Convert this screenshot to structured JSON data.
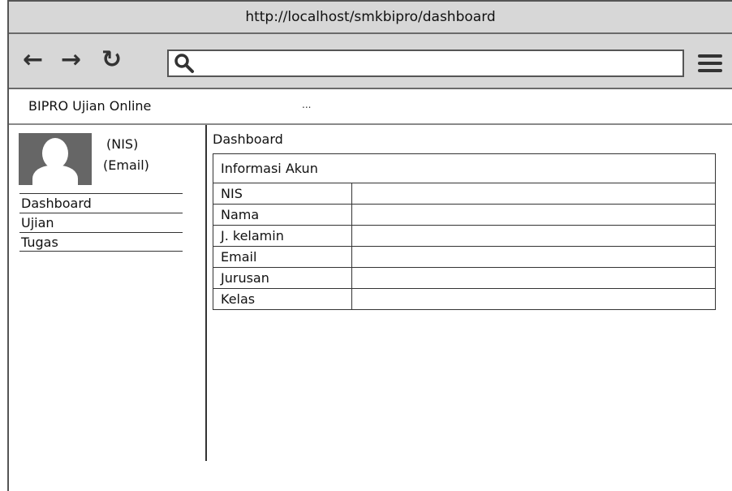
{
  "browser": {
    "url_title": "http://localhost/smkbipro/dashboard",
    "nav": {
      "back": "←",
      "forward": "→",
      "reload": "↻"
    },
    "search_value": ""
  },
  "app": {
    "brand": "BIPRO Ujian Online",
    "more": "..."
  },
  "user": {
    "nis": "(NIS)",
    "email": "(Email)"
  },
  "sidebar": {
    "items": [
      {
        "label": "Dashboard"
      },
      {
        "label": "Ujian"
      },
      {
        "label": "Tugas"
      }
    ]
  },
  "main": {
    "title": "Dashboard",
    "panel_title": "Informasi Akun",
    "rows": [
      {
        "label": "NIS",
        "value": ""
      },
      {
        "label": "Nama",
        "value": ""
      },
      {
        "label": "J. kelamin",
        "value": ""
      },
      {
        "label": "Email",
        "value": ""
      },
      {
        "label": "Jurusan",
        "value": ""
      },
      {
        "label": "Kelas",
        "value": ""
      }
    ]
  },
  "icons": [
    "back-arrow-icon",
    "forward-arrow-icon",
    "reload-icon",
    "search-icon",
    "hamburger-menu-icon",
    "user-avatar-icon"
  ]
}
